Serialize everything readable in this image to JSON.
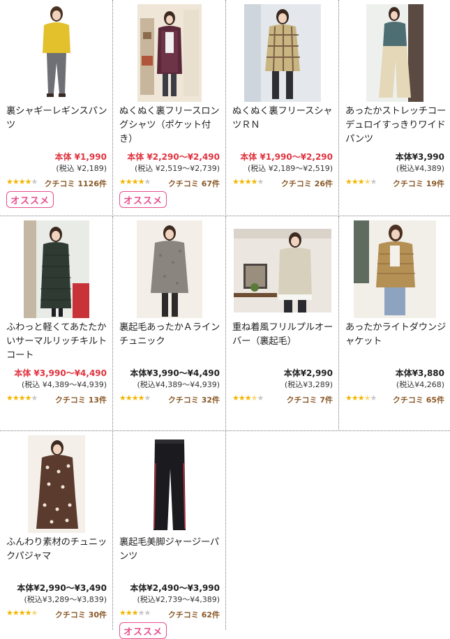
{
  "products": [
    {
      "name": "裏シャギーレギンスパンツ",
      "price": "本体 ¥1,990",
      "tax": "(税込 ¥2,189)",
      "stars": 4,
      "review": "クチコミ 1126件",
      "badge": "オススメ",
      "sale": true
    },
    {
      "name": "ぬくぬく裏フリースロングシャツ（ポケット付き）",
      "price": "本体 ¥2,290〜¥2,490",
      "tax": "(税込 ¥2,519〜¥2,739)",
      "stars": 4,
      "review": "クチコミ 67件",
      "badge": "オススメ",
      "sale": true
    },
    {
      "name": "ぬくぬく裏フリースシャツＲＮ",
      "price": "本体 ¥1,990〜¥2,290",
      "tax": "(税込 ¥2,189〜¥2,519)",
      "stars": 4,
      "review": "クチコミ 26件",
      "badge": "",
      "sale": true
    },
    {
      "name": "あったかストレッチコーデュロイすっきりワイドパンツ",
      "price": "本体¥3,990",
      "tax": "(税込¥4,389)",
      "stars": 3.5,
      "review": "クチコミ 19件",
      "badge": "",
      "sale": false
    },
    {
      "name": "ふわっと軽くてあたたかいサーマルリッチキルトコート",
      "price": "本体 ¥3,990〜¥4,490",
      "tax": "(税込 ¥4,389〜¥4,939)",
      "stars": 4,
      "review": "クチコミ 13件",
      "badge": "",
      "sale": true
    },
    {
      "name": "裏起毛あったかＡラインチュニック",
      "price": "本体¥3,990〜¥4,490",
      "tax": "(税込¥4,389〜¥4,939)",
      "stars": 4,
      "review": "クチコミ 32件",
      "badge": "",
      "sale": false
    },
    {
      "name": "重ね着風フリルプルオーバー（裏起毛）",
      "price": "本体¥2,990",
      "tax": "(税込¥3,289)",
      "stars": 3.5,
      "review": "クチコミ 7件",
      "badge": "",
      "sale": false
    },
    {
      "name": "あったかライトダウンジャケット",
      "price": "本体¥3,880",
      "tax": "(税込¥4,268)",
      "stars": 3.5,
      "review": "クチコミ 65件",
      "badge": "",
      "sale": false
    },
    {
      "name": "ふんわり素材のチュニックパジャマ",
      "price": "本体¥2,990〜¥3,490",
      "tax": "(税込¥3,289〜¥3,839)",
      "stars": 4.5,
      "review": "クチコミ 30件",
      "badge": "",
      "sale": false
    },
    {
      "name": "裏起毛美脚ジャージーパンツ",
      "price": "本体¥2,490〜¥3,990",
      "tax": "(税込¥2,739〜¥4,389)",
      "stars": 3,
      "review": "クチコミ 62件",
      "badge": "オススメ",
      "sale": false
    }
  ]
}
